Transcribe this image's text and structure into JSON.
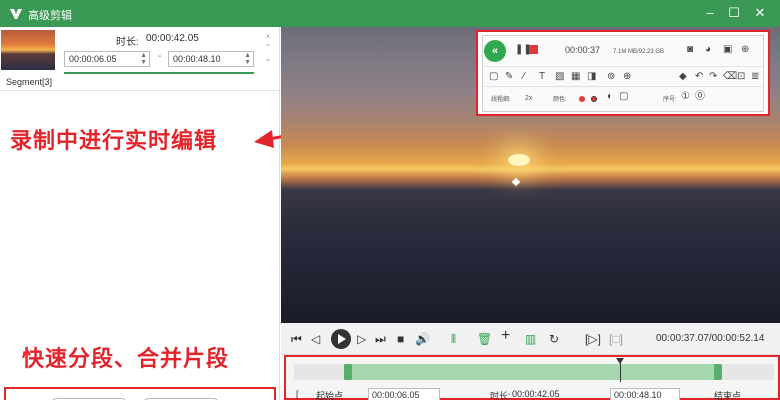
{
  "window": {
    "title": "高级剪辑",
    "minimize": "–",
    "maximize": "☐",
    "close": "✕"
  },
  "segment": {
    "label": "Segment[3]",
    "duration_label": "时长:",
    "duration_value": "00:00:42.05",
    "start_time": "00:00:06.05",
    "end_time": "00:00:48.10",
    "dash": "-",
    "close_icon": "×"
  },
  "annotations": {
    "realtime_edit": "录制中进行实时编辑",
    "split_merge": "快速分段、合并片段"
  },
  "recorder": {
    "collapse": "«",
    "elapsed": "00:00:37",
    "filesize": "7.1M MB/92.23 GB",
    "line_width_label": "线粗细:",
    "line_width_value": "2x",
    "color_label": "颜色:",
    "number_label": "序号:",
    "number_value": "①"
  },
  "player": {
    "current": "00:00:37.07",
    "total": "00:00:52.14",
    "readout": "00:00:37.07/00:00:52.14"
  },
  "timeline": {
    "start_label": "起始点",
    "start_value": "00:00:06.05",
    "duration_label": "时长:",
    "duration_value": "00:00:42.05",
    "end_value": "00:00:48.10",
    "end_label": "结束点"
  },
  "colors": {
    "brand": "#3a9a55",
    "annotation": "#e3242b",
    "record_red": "#e03a3a"
  }
}
